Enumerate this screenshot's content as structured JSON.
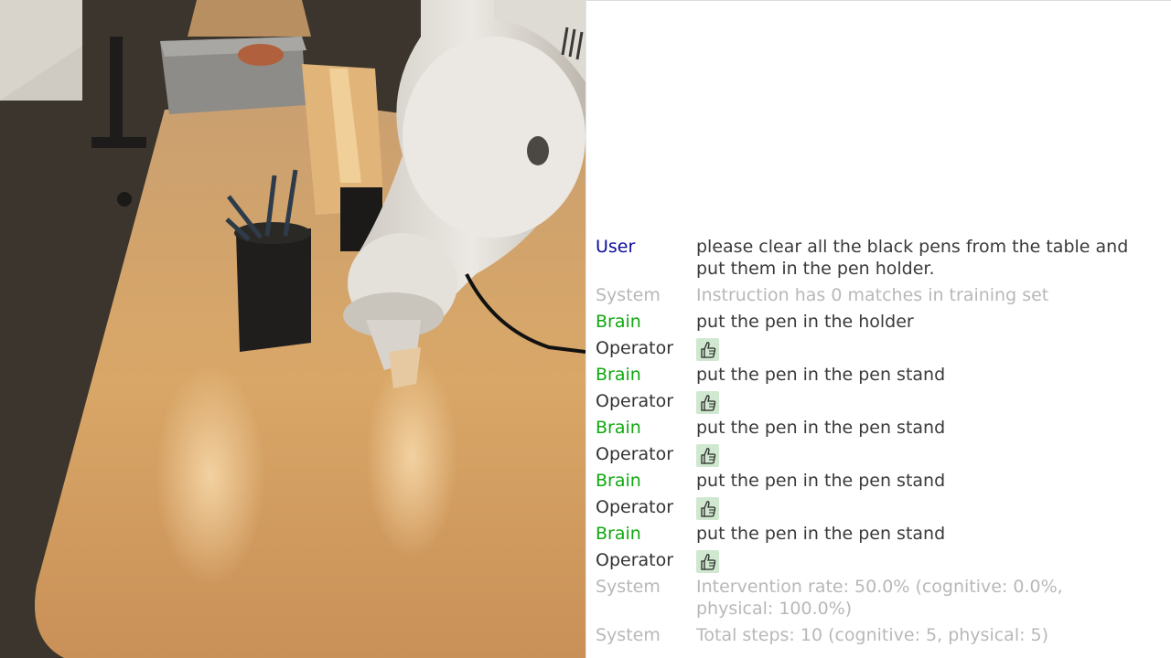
{
  "scene": {
    "description_icon": "robot-arm-camera-view",
    "colors": {
      "table": "#d7a56a",
      "carpet": "#3a342c",
      "arm": "#e6e2dc",
      "wall": "#d4cfc6"
    }
  },
  "log": {
    "entries": [
      {
        "speaker": "User",
        "role": "user",
        "text": "please clear all the black pens from the table and\n put them in the pen holder."
      },
      {
        "speaker": "System",
        "role": "system",
        "text": "Instruction has 0 matches in training set"
      },
      {
        "speaker": "Brain",
        "role": "brain",
        "text": "put the pen in the holder"
      },
      {
        "speaker": "Operator",
        "role": "operator",
        "icon": "thumbs-up-icon"
      },
      {
        "speaker": "Brain",
        "role": "brain",
        "text": "put the pen in the pen stand"
      },
      {
        "speaker": "Operator",
        "role": "operator",
        "icon": "thumbs-up-icon"
      },
      {
        "speaker": "Brain",
        "role": "brain",
        "text": "put the pen in the pen stand"
      },
      {
        "speaker": "Operator",
        "role": "operator",
        "icon": "thumbs-up-icon"
      },
      {
        "speaker": "Brain",
        "role": "brain",
        "text": "put the pen in the pen stand"
      },
      {
        "speaker": "Operator",
        "role": "operator",
        "icon": "thumbs-up-icon"
      },
      {
        "speaker": "Brain",
        "role": "brain",
        "text": "put the pen in the pen stand"
      },
      {
        "speaker": "Operator",
        "role": "operator",
        "icon": "thumbs-up-icon"
      },
      {
        "speaker": "System",
        "role": "system",
        "text": "Intervention rate: 50.0% (cognitive: 0.0%,\n physical: 100.0%)"
      },
      {
        "speaker": "System",
        "role": "system",
        "text": "Total steps: 10 (cognitive: 5, physical: 5)"
      }
    ]
  }
}
